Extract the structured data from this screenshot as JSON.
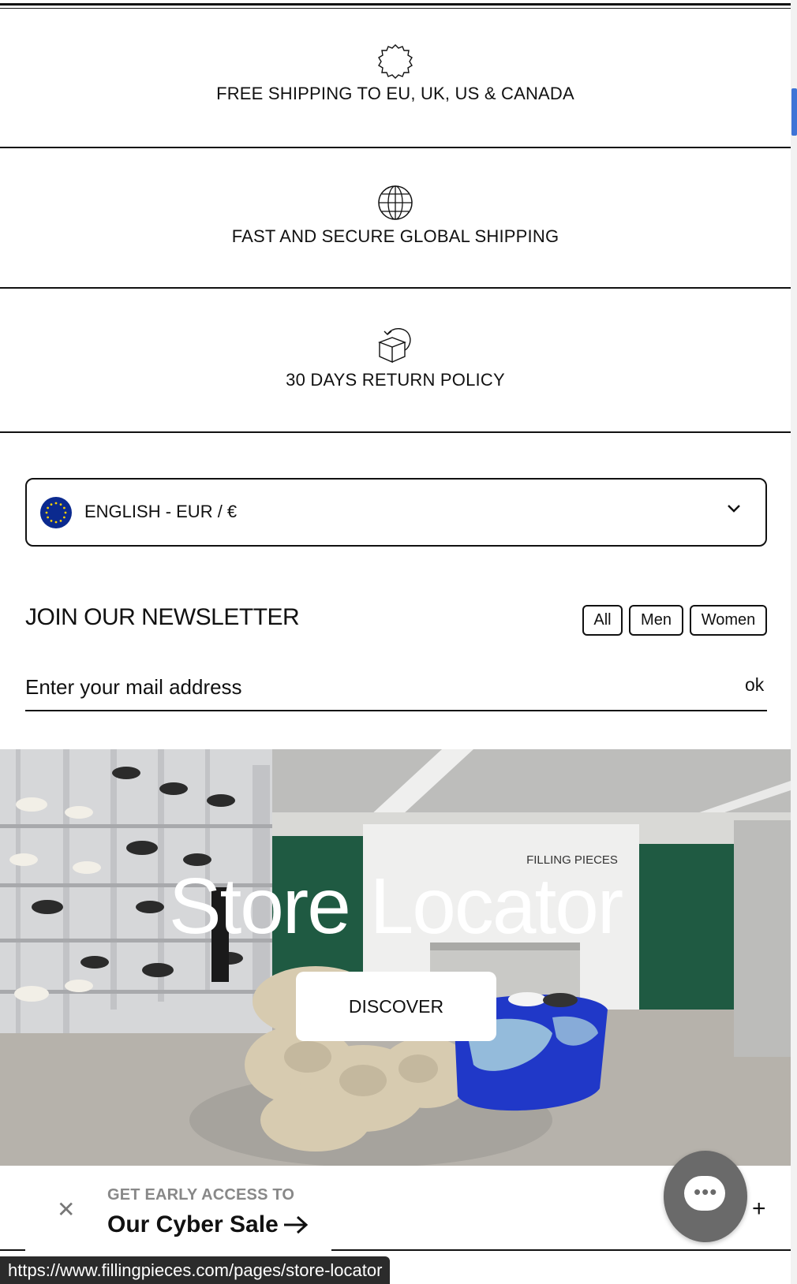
{
  "usps": [
    {
      "label": "FREE SHIPPING TO EU, UK, US & CANADA",
      "icon": "badge-icon"
    },
    {
      "label": "FAST AND SECURE GLOBAL SHIPPING",
      "icon": "globe-icon"
    },
    {
      "label": "30 DAYS RETURN POLICY",
      "icon": "return-box-icon"
    }
  ],
  "locale": {
    "label": "ENGLISH - EUR / €",
    "flag": "eu-flag-icon"
  },
  "newsletter": {
    "title": "JOIN OUR NEWSLETTER",
    "filters": [
      "All",
      "Men",
      "Women"
    ],
    "placeholder": "Enter your mail address",
    "submit": "ok"
  },
  "hero": {
    "title": "Store Locator",
    "button": "DISCOVER",
    "sign": "FILLING PIECES"
  },
  "promo": {
    "kicker": "GET EARLY ACCESS TO",
    "headline": "Our Cyber Sale"
  },
  "status_bar": {
    "url": "https://www.fillingpieces.com/pages/store-locator"
  },
  "colors": {
    "accent_scroll": "#3e74d6",
    "chat": "#6a6a6a",
    "flag": "#0b2a8f"
  }
}
